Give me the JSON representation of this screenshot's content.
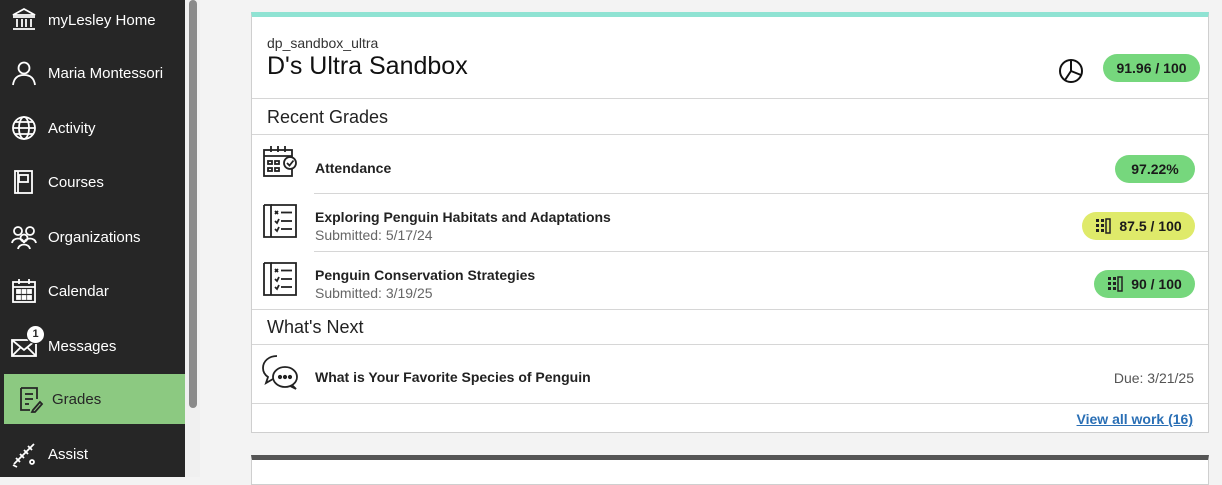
{
  "sidebar": {
    "items": [
      {
        "label": "myLesley Home",
        "icon": "institution-icon"
      },
      {
        "label": "Maria Montessori",
        "icon": "user-icon"
      },
      {
        "label": "Activity",
        "icon": "globe-icon"
      },
      {
        "label": "Courses",
        "icon": "book-icon"
      },
      {
        "label": "Organizations",
        "icon": "people-icon"
      },
      {
        "label": "Calendar",
        "icon": "calendar-icon"
      },
      {
        "label": "Messages",
        "icon": "envelope-icon",
        "badge": "1"
      },
      {
        "label": "Grades",
        "icon": "grades-icon",
        "active": true
      },
      {
        "label": "Assist",
        "icon": "assist-icon"
      }
    ]
  },
  "course": {
    "id": "dp_sandbox_ultra",
    "name": "D's Ultra Sandbox",
    "overall_grade": "91.96 / 100"
  },
  "recent_grades": {
    "title": "Recent Grades",
    "items": [
      {
        "title": "Attendance",
        "grade": "97.22%",
        "color": "#76d77d"
      },
      {
        "title": "Exploring Penguin Habitats and Adaptations",
        "submitted": "Submitted: 5/17/24",
        "grade": "87.5 / 100",
        "color": "#dfea6a"
      },
      {
        "title": "Penguin Conservation Strategies",
        "submitted": "Submitted: 3/19/25",
        "grade": "90 / 100",
        "color": "#76d77d"
      }
    ]
  },
  "whats_next": {
    "title": "What's Next",
    "items": [
      {
        "title": "What is Your Favorite Species of Penguin",
        "due": "Due: 3/21/25"
      }
    ]
  },
  "view_all": "View all work (16)",
  "colors": {
    "accent": "#8cc981",
    "top_border": "#8fe3d3",
    "link": "#2a6fb5"
  }
}
